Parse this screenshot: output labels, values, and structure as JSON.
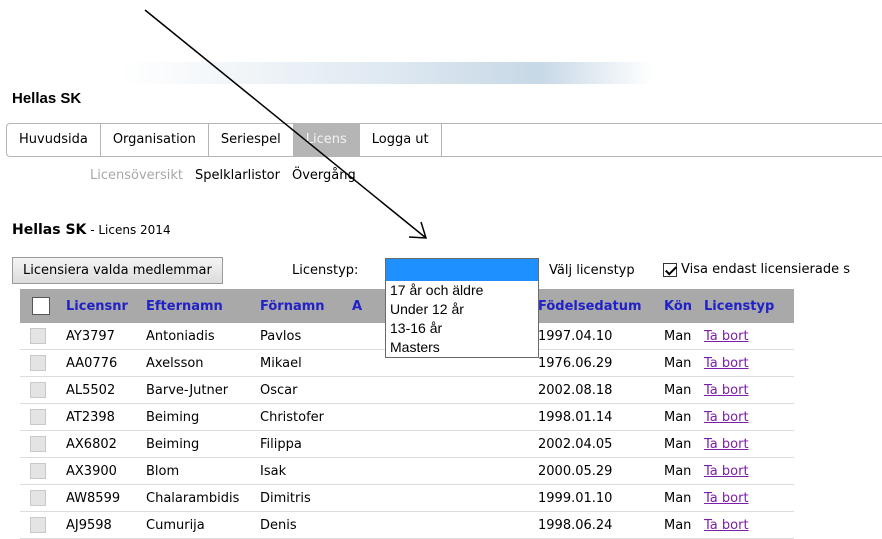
{
  "header": {
    "club_name": "Hellas SK"
  },
  "nav": {
    "tabs": [
      {
        "label": "Huvudsida",
        "active": false
      },
      {
        "label": "Organisation",
        "active": false
      },
      {
        "label": "Seriespel",
        "active": false
      },
      {
        "label": "Licens",
        "active": true
      },
      {
        "label": "Logga ut",
        "active": false
      }
    ],
    "subnav": [
      {
        "label": "Licensöversikt",
        "active": false
      },
      {
        "label": "Spelklarlistor",
        "active": true
      },
      {
        "label": "Övergång",
        "active": true
      }
    ]
  },
  "section": {
    "club": "Hellas SK",
    "subtitle": " - Licens 2014"
  },
  "toolbar": {
    "license_button": "Licensiera valda medlemmar",
    "licenstyp_label": "Licenstyp:",
    "select_hint": "Välj licenstyp",
    "only_licensed_label": "Visa endast licensierade s",
    "only_licensed_checked": true
  },
  "dropdown": {
    "options": [
      "17 år och äldre",
      "Under 12 år",
      "13-16 år",
      "Masters"
    ]
  },
  "table": {
    "headers": {
      "licensnr": "Licensnr",
      "efternamn": "Efternamn",
      "fornamn": "Förnamn",
      "adress": "A",
      "fodelsedatum": "Födelsedatum",
      "kon": "Kön",
      "licenstyp": "Licenstyp"
    },
    "rows": [
      {
        "licensnr": "AY3797",
        "efternamn": "Antoniadis",
        "fornamn": "Pavlos",
        "fodelsedatum": "1997.04.10",
        "kon": "Man",
        "action": "Ta bort"
      },
      {
        "licensnr": "AA0776",
        "efternamn": "Axelsson",
        "fornamn": "Mikael",
        "fodelsedatum": "1976.06.29",
        "kon": "Man",
        "action": "Ta bort"
      },
      {
        "licensnr": "AL5502",
        "efternamn": "Barve-Jutner",
        "fornamn": "Oscar",
        "fodelsedatum": "2002.08.18",
        "kon": "Man",
        "action": "Ta bort"
      },
      {
        "licensnr": "AT2398",
        "efternamn": "Beiming",
        "fornamn": "Christofer",
        "fodelsedatum": "1998.01.14",
        "kon": "Man",
        "action": "Ta bort"
      },
      {
        "licensnr": "AX6802",
        "efternamn": "Beiming",
        "fornamn": "Filippa",
        "fodelsedatum": "2002.04.05",
        "kon": "Man",
        "action": "Ta bort"
      },
      {
        "licensnr": "AX3900",
        "efternamn": "Blom",
        "fornamn": "Isak",
        "fodelsedatum": "2000.05.29",
        "kon": "Man",
        "action": "Ta bort"
      },
      {
        "licensnr": "AW8599",
        "efternamn": "Chalarambidis",
        "fornamn": "Dimitris",
        "fodelsedatum": "1999.01.10",
        "kon": "Man",
        "action": "Ta bort"
      },
      {
        "licensnr": "AJ9598",
        "efternamn": "Cumurija",
        "fornamn": "Denis",
        "fodelsedatum": "1998.06.24",
        "kon": "Man",
        "action": "Ta bort"
      }
    ]
  },
  "colors": {
    "active_tab": "#b5b5b5",
    "table_header_bg": "#a9a9a9",
    "header_text": "#2121c8",
    "link": "#7a1fa8",
    "dropdown_highlight": "#1e90ff"
  }
}
